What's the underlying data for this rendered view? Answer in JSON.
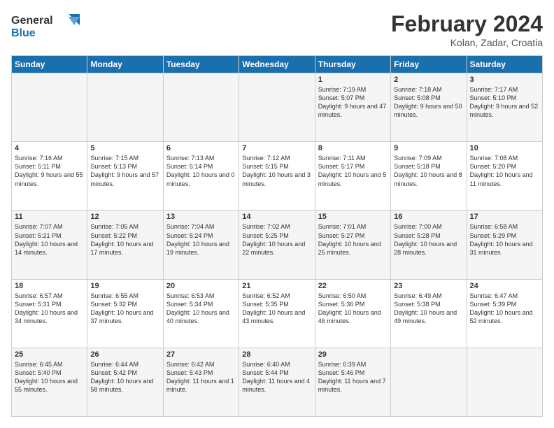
{
  "header": {
    "logo_line1": "General",
    "logo_line2": "Blue",
    "month_title": "February 2024",
    "location": "Kolan, Zadar, Croatia"
  },
  "days_of_week": [
    "Sunday",
    "Monday",
    "Tuesday",
    "Wednesday",
    "Thursday",
    "Friday",
    "Saturday"
  ],
  "weeks": [
    [
      {
        "num": "",
        "info": ""
      },
      {
        "num": "",
        "info": ""
      },
      {
        "num": "",
        "info": ""
      },
      {
        "num": "",
        "info": ""
      },
      {
        "num": "1",
        "info": "Sunrise: 7:19 AM\nSunset: 5:07 PM\nDaylight: 9 hours and 47 minutes."
      },
      {
        "num": "2",
        "info": "Sunrise: 7:18 AM\nSunset: 5:08 PM\nDaylight: 9 hours and 50 minutes."
      },
      {
        "num": "3",
        "info": "Sunrise: 7:17 AM\nSunset: 5:10 PM\nDaylight: 9 hours and 52 minutes."
      }
    ],
    [
      {
        "num": "4",
        "info": "Sunrise: 7:16 AM\nSunset: 5:11 PM\nDaylight: 9 hours and 55 minutes."
      },
      {
        "num": "5",
        "info": "Sunrise: 7:15 AM\nSunset: 5:13 PM\nDaylight: 9 hours and 57 minutes."
      },
      {
        "num": "6",
        "info": "Sunrise: 7:13 AM\nSunset: 5:14 PM\nDaylight: 10 hours and 0 minutes."
      },
      {
        "num": "7",
        "info": "Sunrise: 7:12 AM\nSunset: 5:15 PM\nDaylight: 10 hours and 3 minutes."
      },
      {
        "num": "8",
        "info": "Sunrise: 7:11 AM\nSunset: 5:17 PM\nDaylight: 10 hours and 5 minutes."
      },
      {
        "num": "9",
        "info": "Sunrise: 7:09 AM\nSunset: 5:18 PM\nDaylight: 10 hours and 8 minutes."
      },
      {
        "num": "10",
        "info": "Sunrise: 7:08 AM\nSunset: 5:20 PM\nDaylight: 10 hours and 11 minutes."
      }
    ],
    [
      {
        "num": "11",
        "info": "Sunrise: 7:07 AM\nSunset: 5:21 PM\nDaylight: 10 hours and 14 minutes."
      },
      {
        "num": "12",
        "info": "Sunrise: 7:05 AM\nSunset: 5:22 PM\nDaylight: 10 hours and 17 minutes."
      },
      {
        "num": "13",
        "info": "Sunrise: 7:04 AM\nSunset: 5:24 PM\nDaylight: 10 hours and 19 minutes."
      },
      {
        "num": "14",
        "info": "Sunrise: 7:02 AM\nSunset: 5:25 PM\nDaylight: 10 hours and 22 minutes."
      },
      {
        "num": "15",
        "info": "Sunrise: 7:01 AM\nSunset: 5:27 PM\nDaylight: 10 hours and 25 minutes."
      },
      {
        "num": "16",
        "info": "Sunrise: 7:00 AM\nSunset: 5:28 PM\nDaylight: 10 hours and 28 minutes."
      },
      {
        "num": "17",
        "info": "Sunrise: 6:58 AM\nSunset: 5:29 PM\nDaylight: 10 hours and 31 minutes."
      }
    ],
    [
      {
        "num": "18",
        "info": "Sunrise: 6:57 AM\nSunset: 5:31 PM\nDaylight: 10 hours and 34 minutes."
      },
      {
        "num": "19",
        "info": "Sunrise: 6:55 AM\nSunset: 5:32 PM\nDaylight: 10 hours and 37 minutes."
      },
      {
        "num": "20",
        "info": "Sunrise: 6:53 AM\nSunset: 5:34 PM\nDaylight: 10 hours and 40 minutes."
      },
      {
        "num": "21",
        "info": "Sunrise: 6:52 AM\nSunset: 5:35 PM\nDaylight: 10 hours and 43 minutes."
      },
      {
        "num": "22",
        "info": "Sunrise: 6:50 AM\nSunset: 5:36 PM\nDaylight: 10 hours and 46 minutes."
      },
      {
        "num": "23",
        "info": "Sunrise: 6:49 AM\nSunset: 5:38 PM\nDaylight: 10 hours and 49 minutes."
      },
      {
        "num": "24",
        "info": "Sunrise: 6:47 AM\nSunset: 5:39 PM\nDaylight: 10 hours and 52 minutes."
      }
    ],
    [
      {
        "num": "25",
        "info": "Sunrise: 6:45 AM\nSunset: 5:40 PM\nDaylight: 10 hours and 55 minutes."
      },
      {
        "num": "26",
        "info": "Sunrise: 6:44 AM\nSunset: 5:42 PM\nDaylight: 10 hours and 58 minutes."
      },
      {
        "num": "27",
        "info": "Sunrise: 6:42 AM\nSunset: 5:43 PM\nDaylight: 11 hours and 1 minute."
      },
      {
        "num": "28",
        "info": "Sunrise: 6:40 AM\nSunset: 5:44 PM\nDaylight: 11 hours and 4 minutes."
      },
      {
        "num": "29",
        "info": "Sunrise: 6:39 AM\nSunset: 5:46 PM\nDaylight: 11 hours and 7 minutes."
      },
      {
        "num": "",
        "info": ""
      },
      {
        "num": "",
        "info": ""
      }
    ]
  ]
}
